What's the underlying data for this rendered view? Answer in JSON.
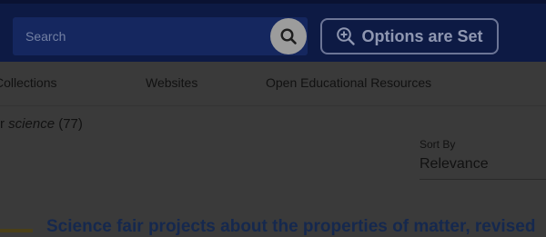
{
  "header": {
    "search_placeholder": "Search",
    "options_label": "Options are Set"
  },
  "nav": {
    "items": [
      "Collections",
      "Websites",
      "Open Educational Resources"
    ]
  },
  "results": {
    "prefix": "r ",
    "query": "science",
    "count": "(77)"
  },
  "sort": {
    "label": "Sort By",
    "value": "Relevance"
  },
  "first_result": {
    "title": "Science fair projects about the properties of matter, revised"
  },
  "icons": {
    "search": "search-icon",
    "options": "zoom-plus-icon"
  }
}
